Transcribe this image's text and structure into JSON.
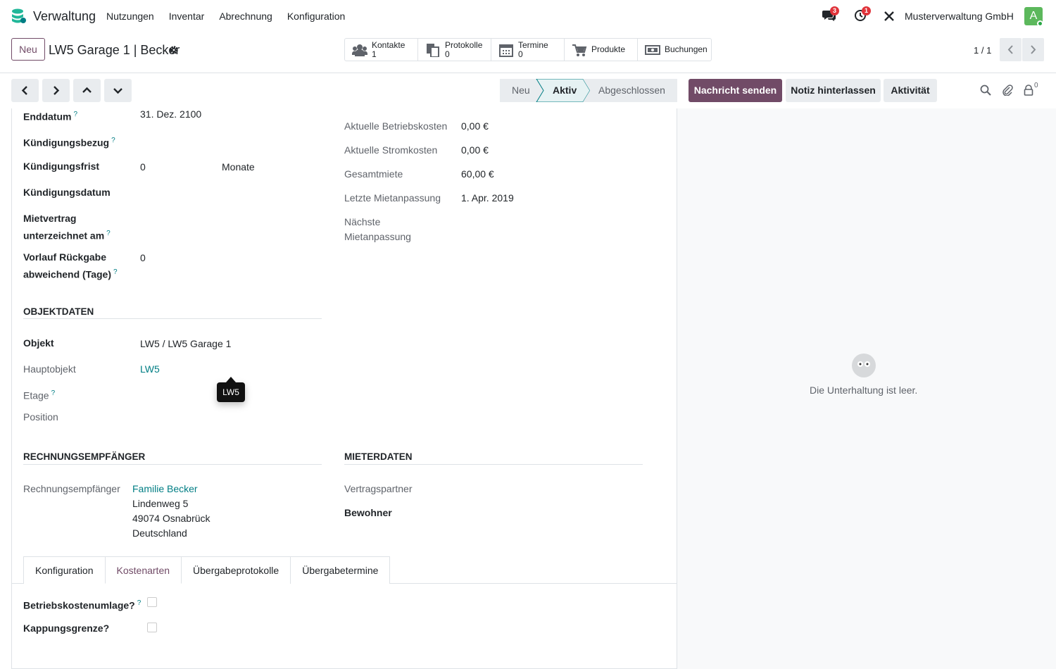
{
  "topbar": {
    "app_name": "Verwaltung",
    "menu": [
      "Nutzungen",
      "Inventar",
      "Abrechnung",
      "Konfiguration"
    ],
    "messages_count": "3",
    "activities_count": "1",
    "company": "Musterverwaltung GmbH",
    "avatar_letter": "A"
  },
  "control": {
    "new_label": "Neu",
    "record_title": "LW5 Garage 1 | Becker",
    "smart_buttons": [
      {
        "label": "Kontakte",
        "count": "1"
      },
      {
        "label": "Protokolle",
        "count": "0"
      },
      {
        "label": "Termine",
        "count": "0"
      },
      {
        "label": "Produkte",
        "count": ""
      },
      {
        "label": "Buchungen",
        "count": ""
      }
    ],
    "pager": "1 / 1"
  },
  "statusbar": {
    "stages": [
      "Neu",
      "Aktiv",
      "Abgeschlossen"
    ],
    "active_stage": "Aktiv"
  },
  "chatter": {
    "send_message": "Nachricht senden",
    "log_note": "Notiz hinterlassen",
    "activity": "Aktivität",
    "followers_count": "0",
    "empty": "Die Unterhaltung ist leer."
  },
  "form": {
    "left": [
      {
        "label": "Enddatum",
        "value": "31. Dez. 2100"
      },
      {
        "label": "Kündigungsbezug",
        "value": ""
      },
      {
        "label": "Kündigungsfrist",
        "value": "0",
        "unit": "Monate"
      },
      {
        "label": "Kündigungsdatum",
        "value": ""
      },
      {
        "label1": "Mietvertrag",
        "label2": "unterzeichnet am",
        "value": ""
      },
      {
        "label1": "Vorlauf Rückgabe",
        "label2": "abweichend (Tage)",
        "value": "0"
      }
    ],
    "right": [
      {
        "label": "Aktuelle Betriebskosten",
        "value": "0,00 €"
      },
      {
        "label": "Aktuelle Stromkosten",
        "value": "0,00 €"
      },
      {
        "label": "Gesamtmiete",
        "value": "60,00 €"
      },
      {
        "label": "Letzte Mietanpassung",
        "value": "1. Apr. 2019"
      },
      {
        "label1": "Nächste",
        "label2": "Mietanpassung",
        "value": ""
      }
    ],
    "objekt_section": "OBJEKTDATEN",
    "objekt": [
      {
        "label": "Objekt",
        "value": "LW5 / LW5 Garage 1"
      },
      {
        "label": "Hauptobjekt",
        "value": "LW5"
      },
      {
        "label": "Etage",
        "value": ""
      },
      {
        "label": "Position",
        "value": ""
      }
    ],
    "tooltip": "LW5",
    "rechnung_section": "RECHNUNGSEMPFÄNGER",
    "rechnung_label": "Rechnungsempfänger",
    "rechnung_name": "Familie Becker",
    "rechnung_street": "Lindenweg 5",
    "rechnung_city": "49074 Osnabrück",
    "rechnung_country": "Deutschland",
    "mieter_section": "MIETERDATEN",
    "vertragspartner": "Vertragspartner",
    "bewohner": "Bewohner",
    "tabs": [
      "Konfiguration",
      "Kostenarten",
      "Übergabeprotokolle",
      "Übergabetermine"
    ],
    "active_tab": "Kostenarten",
    "checks": [
      {
        "label": "Betriebskostenumlage?",
        "checked": false
      },
      {
        "label": "Kappungsgrenze?",
        "checked": false
      }
    ]
  },
  "colors": {
    "brand": "#714b67",
    "link": "#017e84",
    "badge": "#e0333a"
  }
}
